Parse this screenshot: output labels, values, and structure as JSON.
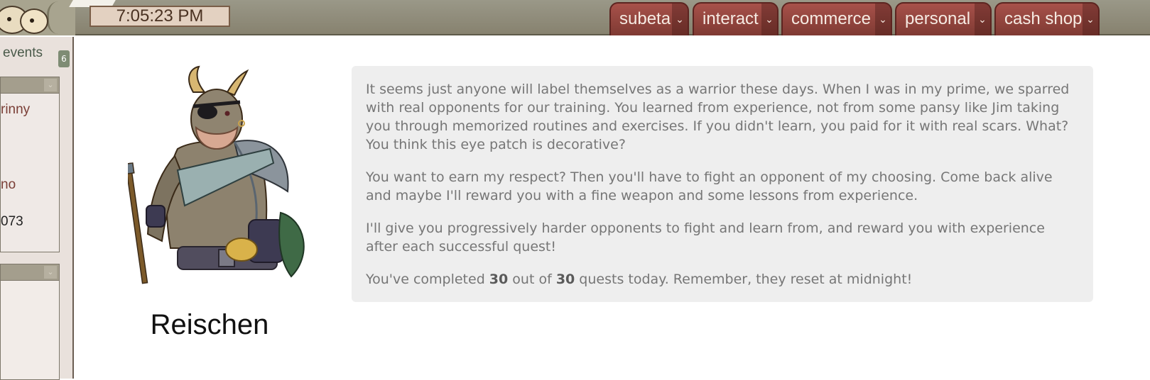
{
  "header": {
    "clock": "7:05:23 PM",
    "nav_tabs": [
      {
        "label": "subeta"
      },
      {
        "label": "interact"
      },
      {
        "label": "commerce"
      },
      {
        "label": "personal"
      },
      {
        "label": "cash shop"
      }
    ]
  },
  "sidebar": {
    "events_label": "events",
    "events_count": "6",
    "panel1_lines": [
      "rinny",
      "no",
      "073"
    ]
  },
  "npc": {
    "name": "Reischen"
  },
  "dialogue": {
    "p1": "It seems just anyone will label themselves as a warrior these days. When I was in my prime, we sparred with real opponents for our training. You learned from experience, not from some pansy like Jim taking you through memorized routines and exercises. If you didn't learn, you paid for it with real scars. What? You think this eye patch is decorative?",
    "p2": "You want to earn my respect? Then you'll have to fight an opponent of my choosing. Come back alive and maybe I'll reward you with a fine weapon and some lessons from experience.",
    "p3": "I'll give you progressively harder opponents to fight and learn from, and reward you with experience after each successful quest!",
    "p4_prefix": "You've completed ",
    "completed": "30",
    "p4_mid": " out of ",
    "total": "30",
    "p4_suffix": " quests today. Remember, they reset at midnight!"
  }
}
